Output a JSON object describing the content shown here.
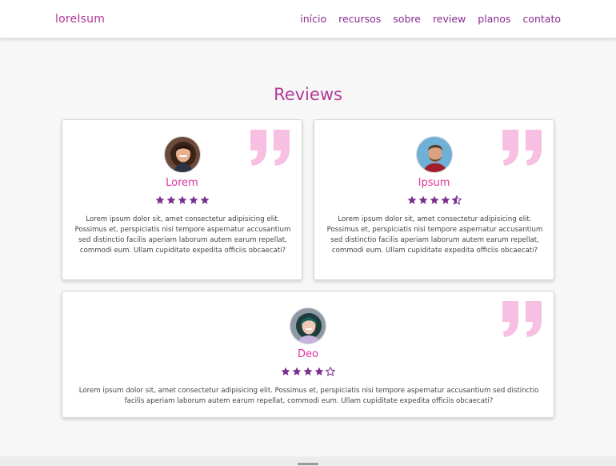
{
  "nav": {
    "logo": "loreIsum",
    "items": [
      "início",
      "recursos",
      "sobre",
      "review",
      "planos",
      "contato"
    ]
  },
  "section_title": "Reviews",
  "reviews": [
    {
      "name": "Lorem",
      "rating": 5,
      "text": "Lorem ipsum dolor sit, amet consectetur adipisicing elit. Possimus et, perspiciatis nisi tempore aspernatur accusantium sed distinctio facilis aperiam laborum autem earum repellat, commodi eum. Ullam cupiditate expedita officiis obcaecati?"
    },
    {
      "name": "Ipsum",
      "rating": 4.5,
      "text": "Lorem ipsum dolor sit, amet consectetur adipisicing elit. Possimus et, perspiciatis nisi tempore aspernatur accusantium sed distinctio facilis aperiam laborum autem earum repellat, commodi eum. Ullam cupiditate expedita officiis obcaecati?"
    },
    {
      "name": "Deo",
      "rating": 4,
      "text": "Lorem ipsum dolor sit, amet consectetur adipisicing elit. Possimus et, perspiciatis nisi tempore aspernatur accusantium sed distinctio facilis aperiam laborum autem earum repellat, commodi eum. Ullam cupiditate expedita officiis obcaecati?"
    }
  ],
  "colors": {
    "accent": "#b43a97",
    "name": "#e0349c",
    "star": "#7a2f8f",
    "quote": "#f7bfe1"
  },
  "icons": {
    "quote": "quote-icon",
    "star": "star-icon"
  }
}
